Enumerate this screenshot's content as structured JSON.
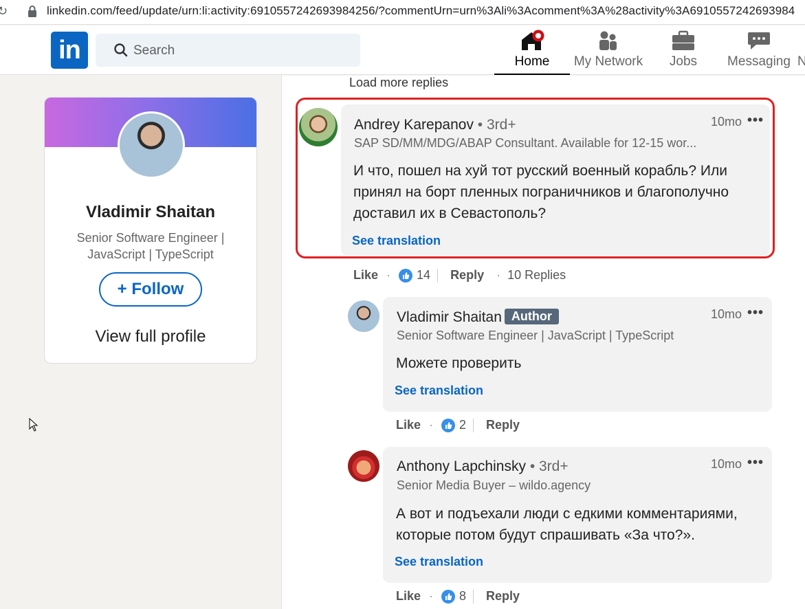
{
  "browser": {
    "url": "linkedin.com/feed/update/urn:li:activity:6910557242693984256/?commentUrn=urn%3Ali%3Acomment%3A%28activity%3A6910557242693984"
  },
  "nav": {
    "logo": "in",
    "search_placeholder": "Search",
    "items": [
      {
        "label": "Home",
        "icon": "home-icon",
        "active": true,
        "notification": true
      },
      {
        "label": "My Network",
        "icon": "people-icon"
      },
      {
        "label": "Jobs",
        "icon": "briefcase-icon"
      },
      {
        "label": "Messaging",
        "icon": "chat-icon"
      },
      {
        "label": "N",
        "icon": "bell-icon"
      }
    ]
  },
  "profile": {
    "name": "Vladimir Shaitan",
    "headline": "Senior Software Engineer | JavaScript | TypeScript",
    "follow_label": "+ Follow",
    "view_profile_label": "View full profile"
  },
  "feed": {
    "load_more": "Load more replies",
    "comments": [
      {
        "author": "Andrey Karepanov",
        "degree": "• 3rd+",
        "headline": "SAP SD/MM/MDG/ABAP Consultant. Available for 12-15 wor...",
        "time": "10mo",
        "text": "И что, пошел на хуй тот русский военный корабль? Или принял на борт пленных пограничников и благополучно доставил их в Севастополь?",
        "see_translation": "See translation",
        "like_label": "Like",
        "like_count": "14",
        "reply_label": "Reply",
        "replies_label": "10 Replies",
        "highlighted": true
      },
      {
        "author": "Vladimir Shaitan",
        "badge": "Author",
        "headline": "Senior Software Engineer | JavaScript | TypeScript",
        "time": "10mo",
        "text": "Можете проверить",
        "see_translation": "See translation",
        "like_label": "Like",
        "like_count": "2",
        "reply_label": "Reply"
      },
      {
        "author": "Anthony Lapchinsky",
        "degree": "• 3rd+",
        "headline": "Senior Media Buyer – wildo.agency",
        "time": "10mo",
        "text": "А вот и подъехали люди с едкими комментариями, которые потом будут спрашивать «За что?».",
        "see_translation": "See translation",
        "like_label": "Like",
        "like_count": "8",
        "reply_label": "Reply"
      }
    ]
  },
  "colors": {
    "linkedin_blue": "#0a66c2",
    "highlight_border": "#e02020",
    "author_badge": "#56687a"
  }
}
